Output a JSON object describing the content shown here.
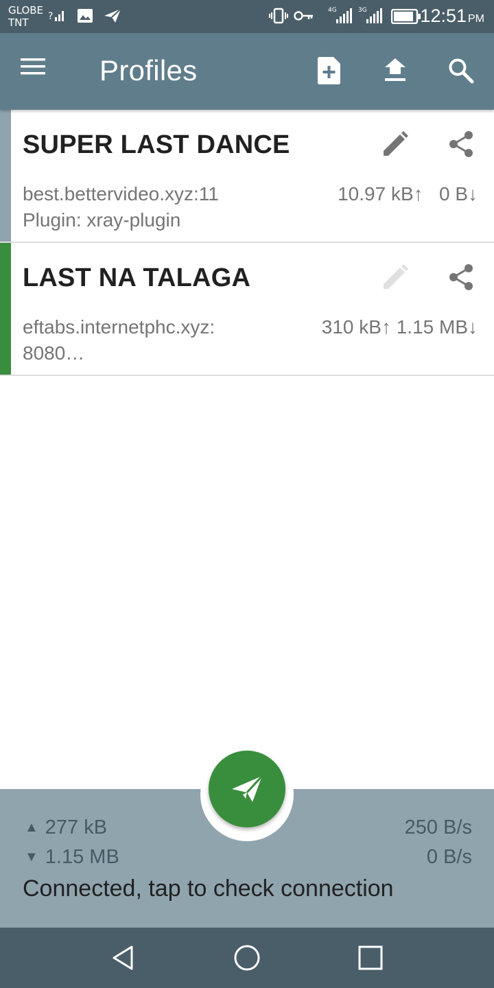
{
  "status_bar": {
    "carrier_line1": "GLOBE",
    "carrier_line2": "TNT",
    "net_4g": "4G",
    "net_3g": "3G",
    "time": "12:51",
    "ampm": "PM",
    "icons": [
      "signal-unknown-icon",
      "image-icon",
      "send-icon",
      "vibrate-icon",
      "key-icon",
      "signal-4g-icon",
      "signal-3g-icon",
      "battery-icon"
    ]
  },
  "toolbar": {
    "title": "Profiles",
    "background": "#607d8b",
    "icons": [
      "menu-icon",
      "add-file-icon",
      "upload-icon",
      "search-icon"
    ]
  },
  "profiles": [
    {
      "name": "SUPER LAST DANCE",
      "host": "best.bettervideo.xyz:11",
      "detail": "Plugin: xray-plugin",
      "traffic": "10.97 kB↑   0 B↓",
      "indicator_color": "#90a4ae",
      "edit_enabled": true
    },
    {
      "name": "LAST NA TALAGA",
      "host": "eftabs.internetphc.xyz:",
      "detail": "8080…",
      "traffic": "310 kB↑ 1.15 MB↓",
      "indicator_color": "#388e3c",
      "edit_enabled": false
    }
  ],
  "stats": {
    "tx_total": "277 kB",
    "rx_total": "1.15 MB",
    "tx_rate": "250 B/s",
    "rx_rate": "0 B/s",
    "status_text": "Connected, tap to check connection",
    "fab_color": "#388e3c"
  },
  "nav_bar": {
    "icons": [
      "back-icon",
      "home-icon",
      "recents-icon"
    ]
  }
}
